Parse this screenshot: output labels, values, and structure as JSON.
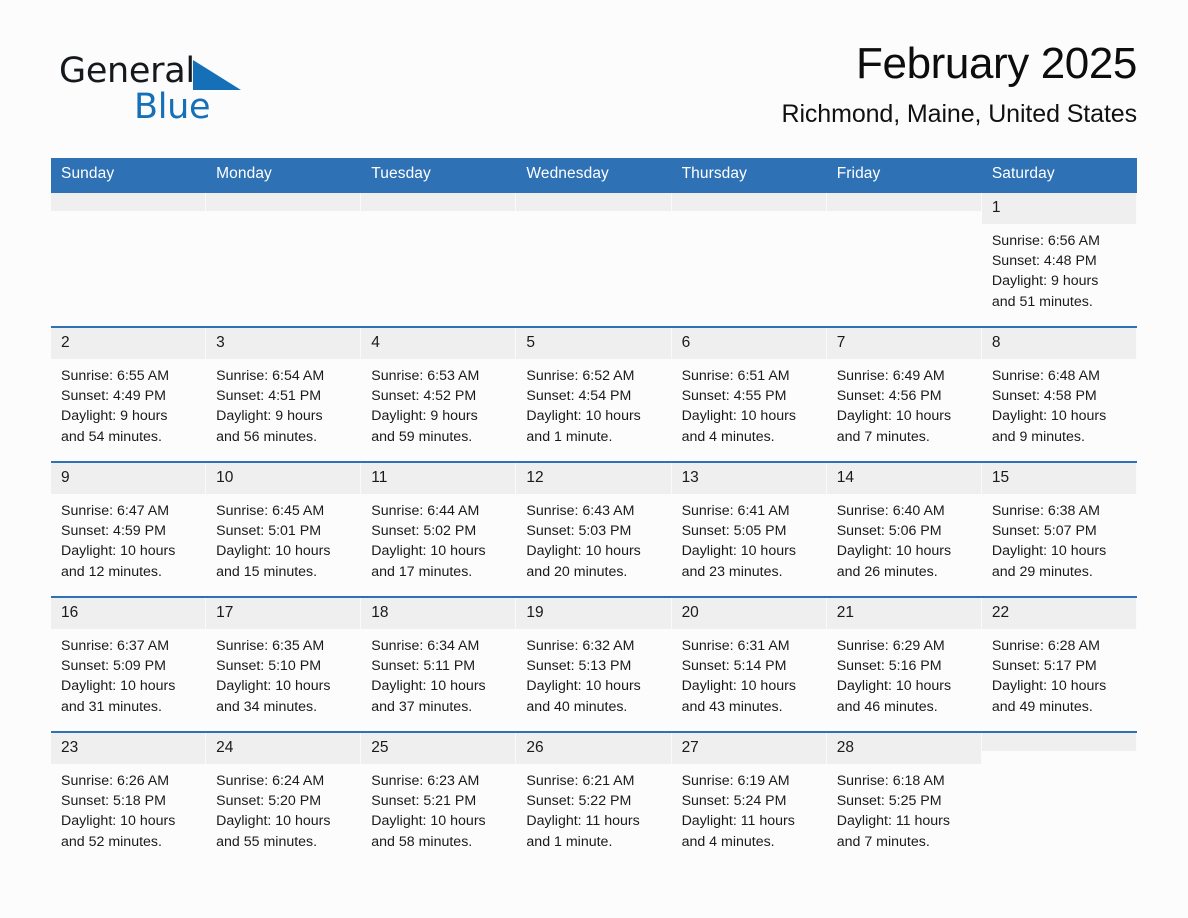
{
  "brand": {
    "name_part1": "General",
    "name_part2": "Blue",
    "accent_color": "#1670b8",
    "triangle_icon": "triangle-logo-icon"
  },
  "header": {
    "month_title": "February 2025",
    "location": "Richmond, Maine, United States"
  },
  "theme": {
    "header_blue": "#2e71b4",
    "daynum_band": "#efefef",
    "page_background": "#fcfcfd",
    "text": "#1a1a1a"
  },
  "weekday_headers": [
    "Sunday",
    "Monday",
    "Tuesday",
    "Wednesday",
    "Thursday",
    "Friday",
    "Saturday"
  ],
  "weeks": [
    [
      {
        "date": "",
        "empty": true,
        "sunrise": "",
        "sunset": "",
        "daylight_line1": "",
        "daylight_line2": ""
      },
      {
        "date": "",
        "empty": true,
        "sunrise": "",
        "sunset": "",
        "daylight_line1": "",
        "daylight_line2": ""
      },
      {
        "date": "",
        "empty": true,
        "sunrise": "",
        "sunset": "",
        "daylight_line1": "",
        "daylight_line2": ""
      },
      {
        "date": "",
        "empty": true,
        "sunrise": "",
        "sunset": "",
        "daylight_line1": "",
        "daylight_line2": ""
      },
      {
        "date": "",
        "empty": true,
        "sunrise": "",
        "sunset": "",
        "daylight_line1": "",
        "daylight_line2": ""
      },
      {
        "date": "",
        "empty": true,
        "sunrise": "",
        "sunset": "",
        "daylight_line1": "",
        "daylight_line2": ""
      },
      {
        "date": "1",
        "empty": false,
        "sunrise": "Sunrise: 6:56 AM",
        "sunset": "Sunset: 4:48 PM",
        "daylight_line1": "Daylight: 9 hours",
        "daylight_line2": "and 51 minutes."
      }
    ],
    [
      {
        "date": "2",
        "empty": false,
        "sunrise": "Sunrise: 6:55 AM",
        "sunset": "Sunset: 4:49 PM",
        "daylight_line1": "Daylight: 9 hours",
        "daylight_line2": "and 54 minutes."
      },
      {
        "date": "3",
        "empty": false,
        "sunrise": "Sunrise: 6:54 AM",
        "sunset": "Sunset: 4:51 PM",
        "daylight_line1": "Daylight: 9 hours",
        "daylight_line2": "and 56 minutes."
      },
      {
        "date": "4",
        "empty": false,
        "sunrise": "Sunrise: 6:53 AM",
        "sunset": "Sunset: 4:52 PM",
        "daylight_line1": "Daylight: 9 hours",
        "daylight_line2": "and 59 minutes."
      },
      {
        "date": "5",
        "empty": false,
        "sunrise": "Sunrise: 6:52 AM",
        "sunset": "Sunset: 4:54 PM",
        "daylight_line1": "Daylight: 10 hours",
        "daylight_line2": "and 1 minute."
      },
      {
        "date": "6",
        "empty": false,
        "sunrise": "Sunrise: 6:51 AM",
        "sunset": "Sunset: 4:55 PM",
        "daylight_line1": "Daylight: 10 hours",
        "daylight_line2": "and 4 minutes."
      },
      {
        "date": "7",
        "empty": false,
        "sunrise": "Sunrise: 6:49 AM",
        "sunset": "Sunset: 4:56 PM",
        "daylight_line1": "Daylight: 10 hours",
        "daylight_line2": "and 7 minutes."
      },
      {
        "date": "8",
        "empty": false,
        "sunrise": "Sunrise: 6:48 AM",
        "sunset": "Sunset: 4:58 PM",
        "daylight_line1": "Daylight: 10 hours",
        "daylight_line2": "and 9 minutes."
      }
    ],
    [
      {
        "date": "9",
        "empty": false,
        "sunrise": "Sunrise: 6:47 AM",
        "sunset": "Sunset: 4:59 PM",
        "daylight_line1": "Daylight: 10 hours",
        "daylight_line2": "and 12 minutes."
      },
      {
        "date": "10",
        "empty": false,
        "sunrise": "Sunrise: 6:45 AM",
        "sunset": "Sunset: 5:01 PM",
        "daylight_line1": "Daylight: 10 hours",
        "daylight_line2": "and 15 minutes."
      },
      {
        "date": "11",
        "empty": false,
        "sunrise": "Sunrise: 6:44 AM",
        "sunset": "Sunset: 5:02 PM",
        "daylight_line1": "Daylight: 10 hours",
        "daylight_line2": "and 17 minutes."
      },
      {
        "date": "12",
        "empty": false,
        "sunrise": "Sunrise: 6:43 AM",
        "sunset": "Sunset: 5:03 PM",
        "daylight_line1": "Daylight: 10 hours",
        "daylight_line2": "and 20 minutes."
      },
      {
        "date": "13",
        "empty": false,
        "sunrise": "Sunrise: 6:41 AM",
        "sunset": "Sunset: 5:05 PM",
        "daylight_line1": "Daylight: 10 hours",
        "daylight_line2": "and 23 minutes."
      },
      {
        "date": "14",
        "empty": false,
        "sunrise": "Sunrise: 6:40 AM",
        "sunset": "Sunset: 5:06 PM",
        "daylight_line1": "Daylight: 10 hours",
        "daylight_line2": "and 26 minutes."
      },
      {
        "date": "15",
        "empty": false,
        "sunrise": "Sunrise: 6:38 AM",
        "sunset": "Sunset: 5:07 PM",
        "daylight_line1": "Daylight: 10 hours",
        "daylight_line2": "and 29 minutes."
      }
    ],
    [
      {
        "date": "16",
        "empty": false,
        "sunrise": "Sunrise: 6:37 AM",
        "sunset": "Sunset: 5:09 PM",
        "daylight_line1": "Daylight: 10 hours",
        "daylight_line2": "and 31 minutes."
      },
      {
        "date": "17",
        "empty": false,
        "sunrise": "Sunrise: 6:35 AM",
        "sunset": "Sunset: 5:10 PM",
        "daylight_line1": "Daylight: 10 hours",
        "daylight_line2": "and 34 minutes."
      },
      {
        "date": "18",
        "empty": false,
        "sunrise": "Sunrise: 6:34 AM",
        "sunset": "Sunset: 5:11 PM",
        "daylight_line1": "Daylight: 10 hours",
        "daylight_line2": "and 37 minutes."
      },
      {
        "date": "19",
        "empty": false,
        "sunrise": "Sunrise: 6:32 AM",
        "sunset": "Sunset: 5:13 PM",
        "daylight_line1": "Daylight: 10 hours",
        "daylight_line2": "and 40 minutes."
      },
      {
        "date": "20",
        "empty": false,
        "sunrise": "Sunrise: 6:31 AM",
        "sunset": "Sunset: 5:14 PM",
        "daylight_line1": "Daylight: 10 hours",
        "daylight_line2": "and 43 minutes."
      },
      {
        "date": "21",
        "empty": false,
        "sunrise": "Sunrise: 6:29 AM",
        "sunset": "Sunset: 5:16 PM",
        "daylight_line1": "Daylight: 10 hours",
        "daylight_line2": "and 46 minutes."
      },
      {
        "date": "22",
        "empty": false,
        "sunrise": "Sunrise: 6:28 AM",
        "sunset": "Sunset: 5:17 PM",
        "daylight_line1": "Daylight: 10 hours",
        "daylight_line2": "and 49 minutes."
      }
    ],
    [
      {
        "date": "23",
        "empty": false,
        "sunrise": "Sunrise: 6:26 AM",
        "sunset": "Sunset: 5:18 PM",
        "daylight_line1": "Daylight: 10 hours",
        "daylight_line2": "and 52 minutes."
      },
      {
        "date": "24",
        "empty": false,
        "sunrise": "Sunrise: 6:24 AM",
        "sunset": "Sunset: 5:20 PM",
        "daylight_line1": "Daylight: 10 hours",
        "daylight_line2": "and 55 minutes."
      },
      {
        "date": "25",
        "empty": false,
        "sunrise": "Sunrise: 6:23 AM",
        "sunset": "Sunset: 5:21 PM",
        "daylight_line1": "Daylight: 10 hours",
        "daylight_line2": "and 58 minutes."
      },
      {
        "date": "26",
        "empty": false,
        "sunrise": "Sunrise: 6:21 AM",
        "sunset": "Sunset: 5:22 PM",
        "daylight_line1": "Daylight: 11 hours",
        "daylight_line2": "and 1 minute."
      },
      {
        "date": "27",
        "empty": false,
        "sunrise": "Sunrise: 6:19 AM",
        "sunset": "Sunset: 5:24 PM",
        "daylight_line1": "Daylight: 11 hours",
        "daylight_line2": "and 4 minutes."
      },
      {
        "date": "28",
        "empty": false,
        "sunrise": "Sunrise: 6:18 AM",
        "sunset": "Sunset: 5:25 PM",
        "daylight_line1": "Daylight: 11 hours",
        "daylight_line2": "and 7 minutes."
      },
      {
        "date": "",
        "empty": true,
        "sunrise": "",
        "sunset": "",
        "daylight_line1": "",
        "daylight_line2": ""
      }
    ]
  ]
}
